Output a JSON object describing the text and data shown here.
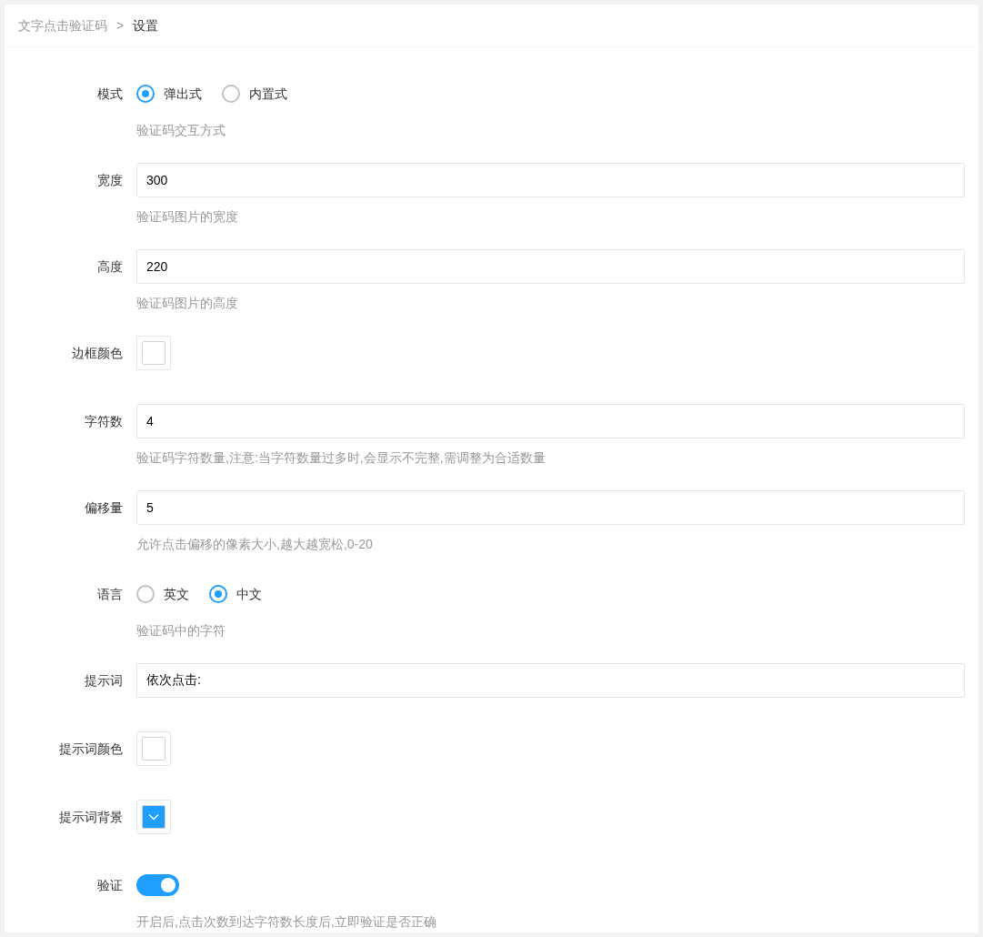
{
  "breadcrumb": [
    {
      "label": "文字点击验证码",
      "current": false
    },
    {
      "label": "设置",
      "current": true
    }
  ],
  "breadcrumb_separator": ">",
  "fields": [
    {
      "kind": "radio",
      "label": "模式",
      "options": [
        {
          "label": "弹出式",
          "selected": true
        },
        {
          "label": "内置式",
          "selected": false
        }
      ],
      "help": "验证码交互方式"
    },
    {
      "kind": "text",
      "label": "宽度",
      "value": "300",
      "help": "验证码图片的宽度"
    },
    {
      "kind": "text",
      "label": "高度",
      "value": "220",
      "help": "验证码图片的高度"
    },
    {
      "kind": "color",
      "label": "边框颜色",
      "color": "#ffffff"
    },
    {
      "kind": "text",
      "label": "字符数",
      "value": "4",
      "help": "验证码字符数量,注意:当字符数量过多时,会显示不完整,需调整为合适数量"
    },
    {
      "kind": "text",
      "label": "偏移量",
      "value": "5",
      "help": "允许点击偏移的像素大小,越大越宽松,0-20"
    },
    {
      "kind": "radio",
      "label": "语言",
      "options": [
        {
          "label": "英文",
          "selected": false
        },
        {
          "label": "中文",
          "selected": true
        }
      ],
      "help": "验证码中的字符"
    },
    {
      "kind": "text",
      "label": "提示词",
      "value": "依次点击:"
    },
    {
      "kind": "color",
      "label": "提示词颜色",
      "color": "#ffffff"
    },
    {
      "kind": "color",
      "label": "提示词背景",
      "color": "#1e9fff"
    },
    {
      "kind": "switch",
      "label": "验证",
      "on": true,
      "help": "开启后,点击次数到达字符数长度后,立即验证是否正确"
    }
  ]
}
